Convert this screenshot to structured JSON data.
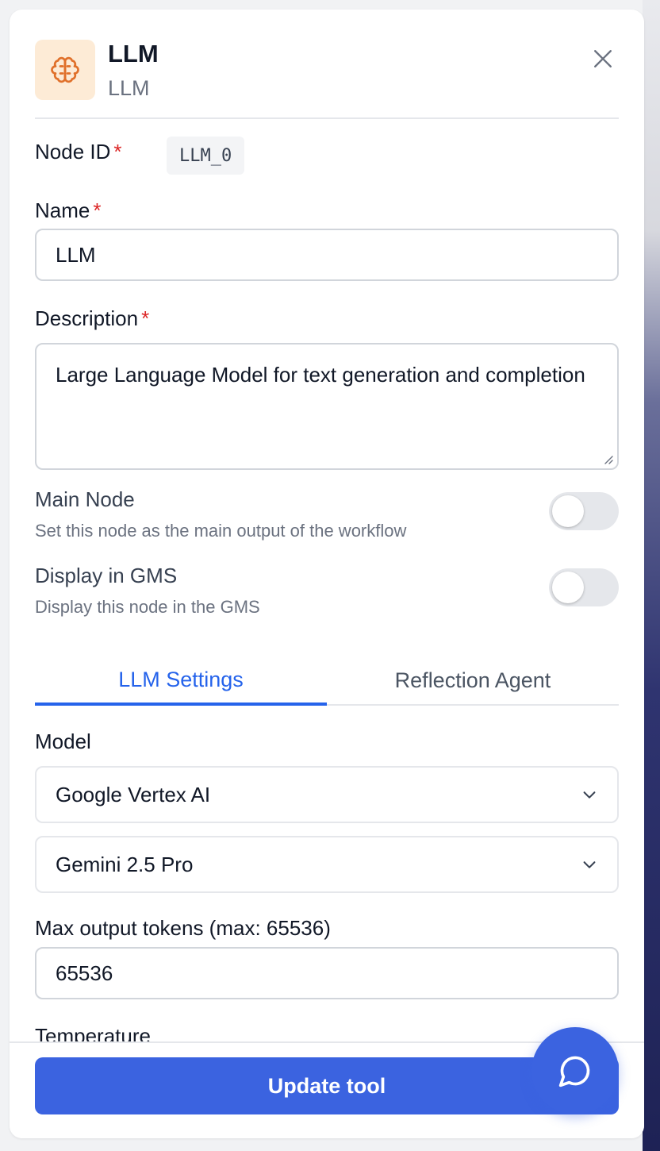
{
  "header": {
    "title": "LLM",
    "subtitle": "LLM",
    "icon": "brain-icon",
    "icon_color": "#e0702a"
  },
  "node_id": {
    "label": "Node ID",
    "required_mark": "*",
    "value": "LLM_0"
  },
  "name": {
    "label": "Name",
    "required_mark": "*",
    "value": "LLM"
  },
  "description": {
    "label": "Description",
    "required_mark": "*",
    "value": "Large Language Model for text generation and completion"
  },
  "main_node": {
    "title": "Main Node",
    "description": "Set this node as the main output of the workflow",
    "enabled": false
  },
  "display_gms": {
    "title": "Display in GMS",
    "description": "Display this node in the GMS",
    "enabled": false
  },
  "tabs": [
    {
      "label": "LLM Settings",
      "active": true
    },
    {
      "label": "Reflection Agent",
      "active": false
    }
  ],
  "model": {
    "label": "Model",
    "provider": "Google Vertex AI",
    "model_name": "Gemini 2.5 Pro"
  },
  "max_tokens": {
    "label": "Max output tokens (max: 65536)",
    "value": "65536"
  },
  "temperature": {
    "label": "Temperature"
  },
  "footer": {
    "button_label": "Update tool"
  },
  "colors": {
    "accent": "#3b63e0",
    "tab_active": "#2563eb",
    "required": "#dc2626"
  }
}
